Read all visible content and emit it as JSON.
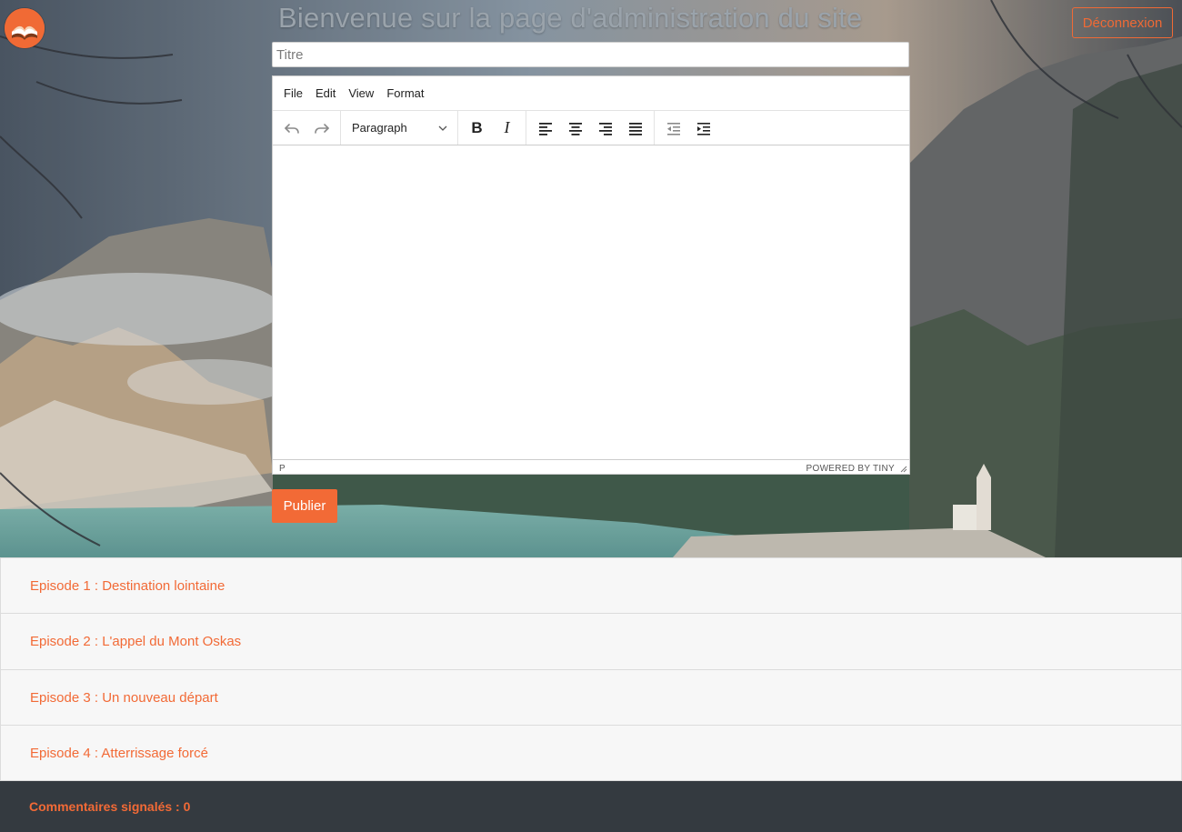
{
  "header": {
    "title": "Bienvenue sur la page d'administration du site",
    "logout_label": "Déconnexion"
  },
  "form": {
    "title_placeholder": "Titre",
    "publish_label": "Publier"
  },
  "editor": {
    "menu": [
      "File",
      "Edit",
      "View",
      "Format"
    ],
    "format_select": "Paragraph",
    "status_path": "P",
    "powered_by": "POWERED BY TINY"
  },
  "episodes": [
    "Episode 1 : Destination lointaine",
    "Episode 2 : L'appel du Mont Oskas",
    "Episode 3 : Un nouveau départ",
    "Episode 4 : Atterrissage forcé"
  ],
  "reported_comments": "Commentaires signalés : 0",
  "colors": {
    "accent": "#f26a36",
    "dark_bar": "#343a40",
    "list_bg": "#f7f7f7"
  },
  "icons": [
    "logo-book-icon",
    "undo-icon",
    "redo-icon",
    "chevron-down-icon",
    "bold-icon",
    "italic-icon",
    "align-left-icon",
    "align-center-icon",
    "align-right-icon",
    "align-justify-icon",
    "outdent-icon",
    "indent-icon",
    "resize-handle-icon"
  ]
}
